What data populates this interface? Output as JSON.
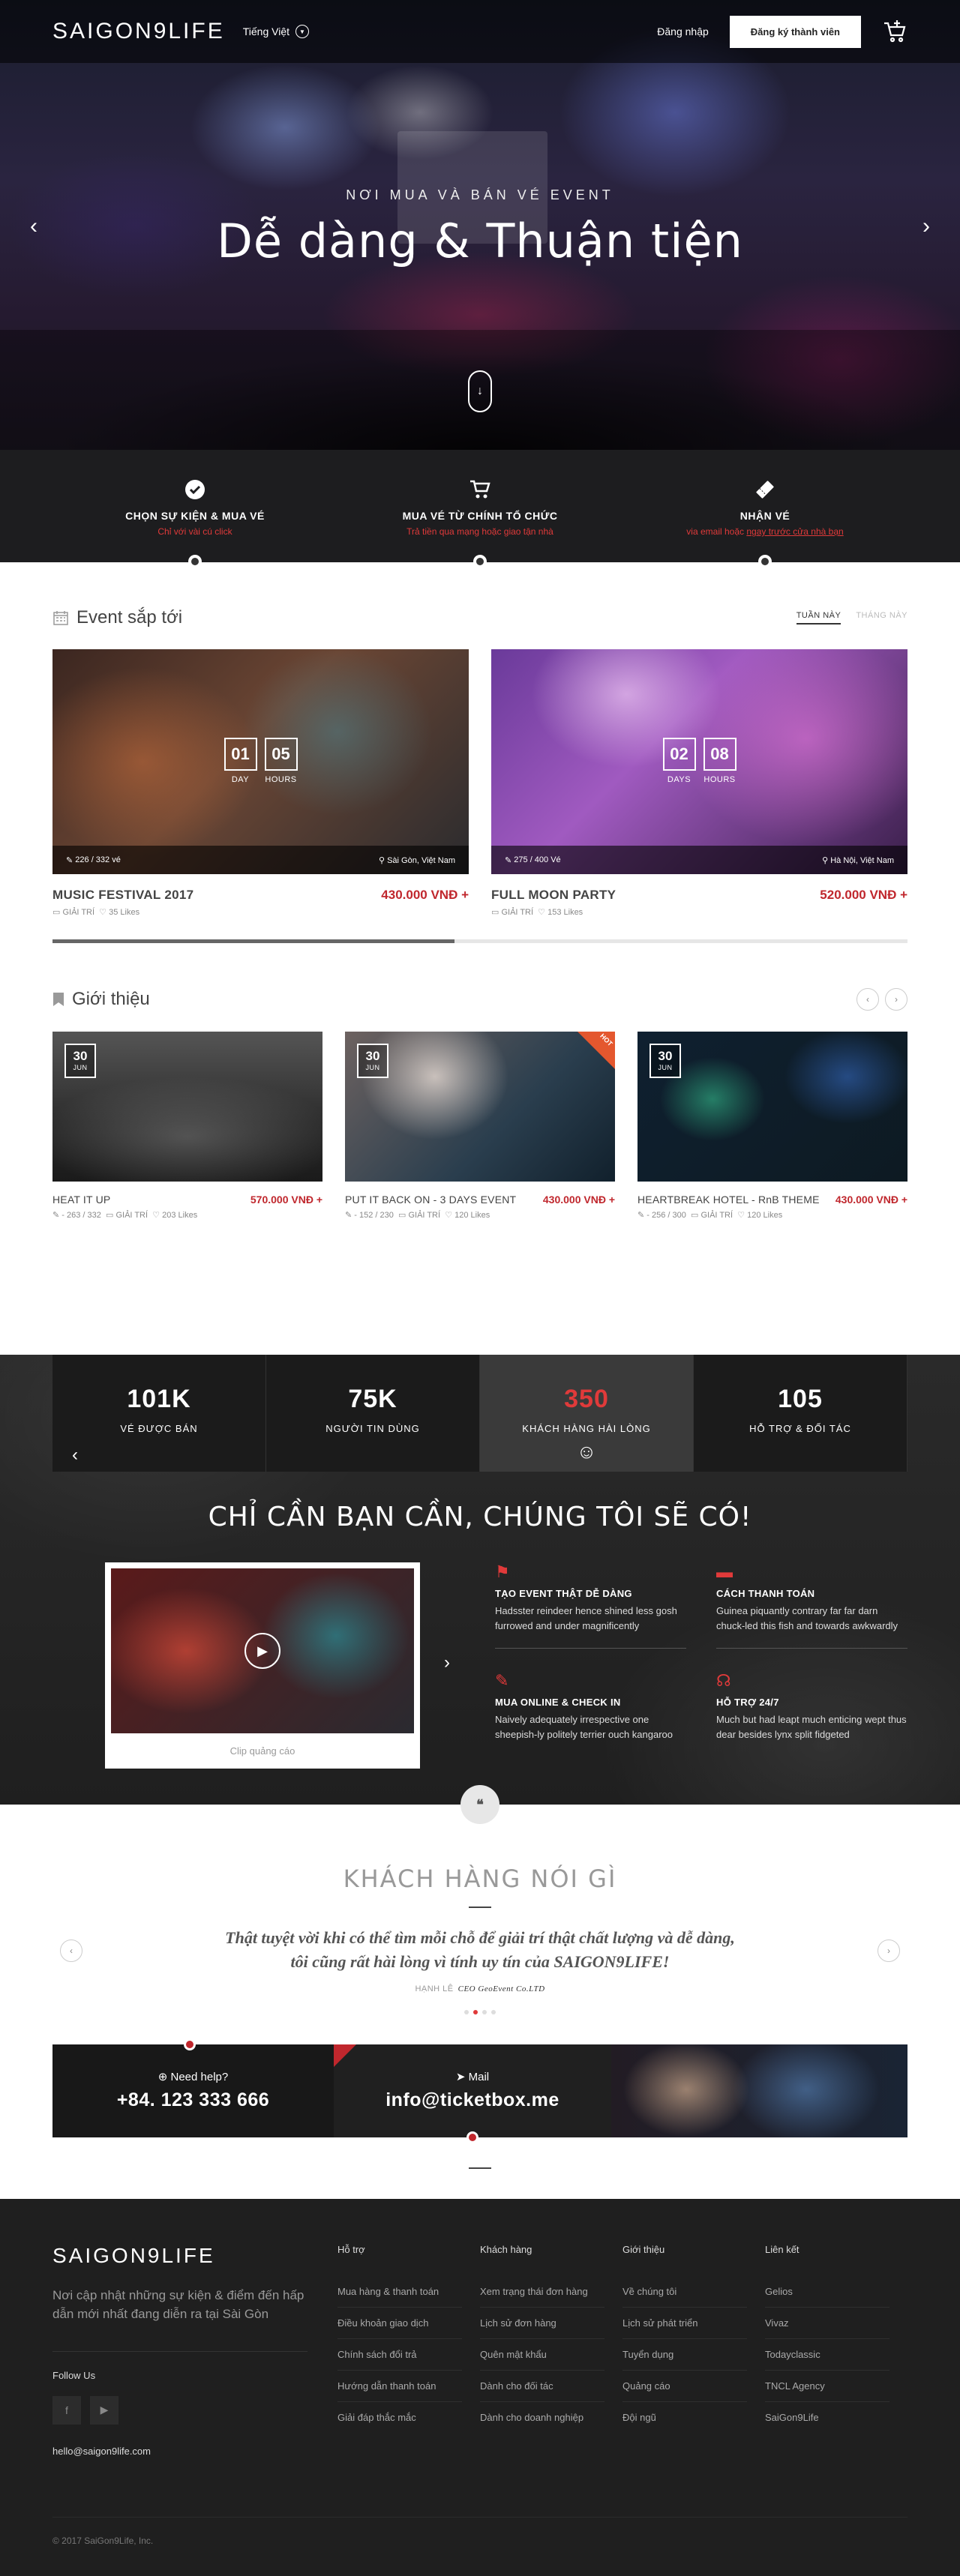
{
  "header": {
    "logo": "SAIGON9LIFE",
    "language": "Tiếng Việt",
    "login": "Đăng nhập",
    "register": "Đăng ký thành viên"
  },
  "hero": {
    "kicker": "NƠI MUA VÀ BÁN VÉ EVENT",
    "title": "Dễ dàng & Thuận tiện"
  },
  "steps": [
    {
      "title": "CHỌN SỰ KIỆN & MUA VÉ",
      "sub": "Chỉ với vài cú click",
      "icon": "check-circle-icon"
    },
    {
      "title": "MUA VÉ TỪ CHÍNH TỔ CHỨC",
      "sub": "Trả tiền qua mạng hoặc giao tận nhà",
      "icon": "cart-icon"
    },
    {
      "title": "NHẬN VÉ",
      "sub_pre": "via email hoặc ",
      "sub_link": "ngay trước cửa nhà bạn",
      "icon": "ticket-icon"
    }
  ],
  "upcoming": {
    "title": "Event sắp tới",
    "tabs": [
      "TUẦN NÀY",
      "THÁNG NÀY"
    ],
    "progress": 0.47,
    "events": [
      {
        "name": "MUSIC FESTIVAL 2017",
        "price": "430.000 VNĐ +",
        "days": "01",
        "hours": "05",
        "days_label": "DAY",
        "hours_label": "HOURS",
        "tickets": "226 / 332 vé",
        "location": "Sài Gòn, Việt Nam",
        "category": "GIẢI TRÍ",
        "likes": "35 Likes"
      },
      {
        "name": "FULL MOON PARTY",
        "price": "520.000 VNĐ +",
        "days": "02",
        "hours": "08",
        "days_label": "DAYS",
        "hours_label": "HOURS",
        "tickets": "275 / 400 Vé",
        "location": "Hà Nội, Việt Nam",
        "category": "GIẢI TRÍ",
        "likes": "153 Likes"
      }
    ]
  },
  "intro": {
    "title": "Giới thiệu",
    "cards": [
      {
        "name": "HEAT IT UP",
        "price": "570.000 VNĐ +",
        "day": "30",
        "month": "JUN",
        "sold": "263",
        "total": "332",
        "category": "GIẢI TRÍ",
        "likes": "203 Likes",
        "hot": ""
      },
      {
        "name": "PUT IT BACK ON - 3 DAYS EVENT",
        "price": "430.000 VNĐ +",
        "day": "30",
        "month": "JUN",
        "sold": "152",
        "total": "230",
        "category": "GIẢI TRÍ",
        "likes": "120 Likes",
        "hot": "HOT"
      },
      {
        "name": "HEARTBREAK HOTEL - RnB THEME",
        "price": "430.000 VNĐ +",
        "day": "30",
        "month": "JUN",
        "sold": "256",
        "total": "300",
        "category": "GIẢI TRÍ",
        "likes": "120 Likes",
        "hot": ""
      }
    ]
  },
  "stats": [
    {
      "value": "101K",
      "label": "VÉ ĐƯỢC BÁN"
    },
    {
      "value": "75K",
      "label": "NGƯỜI TIN DÙNG"
    },
    {
      "value": "350",
      "label": "KHÁCH HÀNG HÀI LÒNG",
      "smile": "☺"
    },
    {
      "value": "105",
      "label": "HỖ TRỢ & ĐỐI TÁC"
    }
  ],
  "promo": {
    "title": "CHỈ CẦN BẠN CẦN, CHÚNG TÔI SẼ CÓ!",
    "video_caption": "Clip quảng cáo",
    "features": [
      {
        "title": "TẠO EVENT THẬT DỄ DÀNG",
        "desc": "Hadsster reindeer hence shined less gosh furrowed and under magnificently",
        "icon": "flag-icon"
      },
      {
        "title": "CÁCH THANH TOÁN",
        "desc": "Guinea piquantly contrary far far darn chuck-led this fish and towards awkwardly",
        "icon": "credit-card-icon"
      },
      {
        "title": "MUA ONLINE & CHECK IN",
        "desc": "Naively adequately irrespective one sheepish-ly politely terrier ouch kangaroo",
        "icon": "ticket-icon"
      },
      {
        "title": "HỖ TRỢ 24/7",
        "desc": "Much but had leapt much enticing wept thus dear besides lynx split fidgeted",
        "icon": "headset-icon"
      }
    ]
  },
  "testimonial": {
    "title": "KHÁCH HÀNG NÓI GÌ",
    "quote": "Thật tuyệt vời khi có thể tìm mỗi chỗ để giải trí thật chất lượng và dễ dàng, tôi cũng rất hài lòng vì tính uy tín của SAIGON9LIFE!",
    "author": "HẠNH LÊ",
    "company": "CEO GeoEvent Co.LTD"
  },
  "contact": {
    "help_label": "Need help?",
    "phone": "+84. 123 333 666",
    "mail_label": "Mail",
    "email": "info@ticketbox.me"
  },
  "footer": {
    "logo": "SAIGON9LIFE",
    "tagline": "Nơi cập nhật những sự kiện & điểm đến hấp dẫn mới nhất đang diễn ra tại Sài Gòn",
    "follow": "Follow Us",
    "email": "hello@saigon9life.com",
    "copyright": "© 2017 SaiGon9Life, Inc.",
    "columns": [
      {
        "title": "Hỗ trợ",
        "links": [
          "Mua hàng & thanh toán",
          "Điều khoản giao dịch",
          "Chính sách đổi trả",
          "Hướng dẫn thanh toán",
          "Giải đáp thắc mắc"
        ]
      },
      {
        "title": "Khách hàng",
        "links": [
          "Xem trạng thái đơn hàng",
          "Lịch sử đơn hàng",
          "Quên mật khẩu",
          "Dành cho đối tác",
          "Dành cho doanh nghiệp"
        ]
      },
      {
        "title": "Giới thiệu",
        "links": [
          "Về chúng tôi",
          "Lịch sử phát triển",
          "Tuyển dụng",
          "Quảng cáo",
          "Đội ngũ"
        ]
      },
      {
        "title": "Liên kết",
        "links": [
          "Gelios",
          "Vivaz",
          "Todayclassic",
          "TNCL Agency",
          "SaiGon9Life"
        ]
      }
    ]
  }
}
